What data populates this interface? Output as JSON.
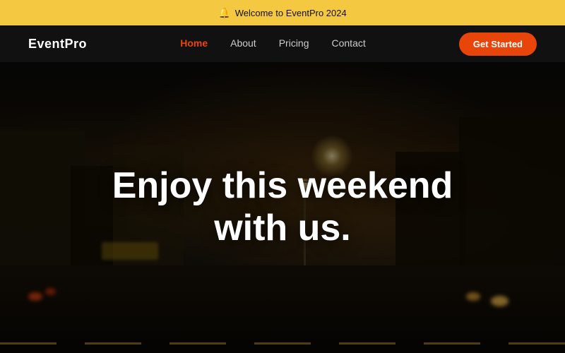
{
  "announcement": {
    "text": "Welcome to EventPro 2024",
    "icon": "🔔"
  },
  "nav": {
    "logo": "EventPro",
    "links": [
      {
        "label": "Home",
        "active": true
      },
      {
        "label": "About",
        "active": false
      },
      {
        "label": "Pricing",
        "active": false
      },
      {
        "label": "Contact",
        "active": false
      }
    ],
    "cta_label": "Get Started"
  },
  "hero": {
    "heading_line1": "Enjoy this weekend",
    "heading_line2": "with us."
  }
}
